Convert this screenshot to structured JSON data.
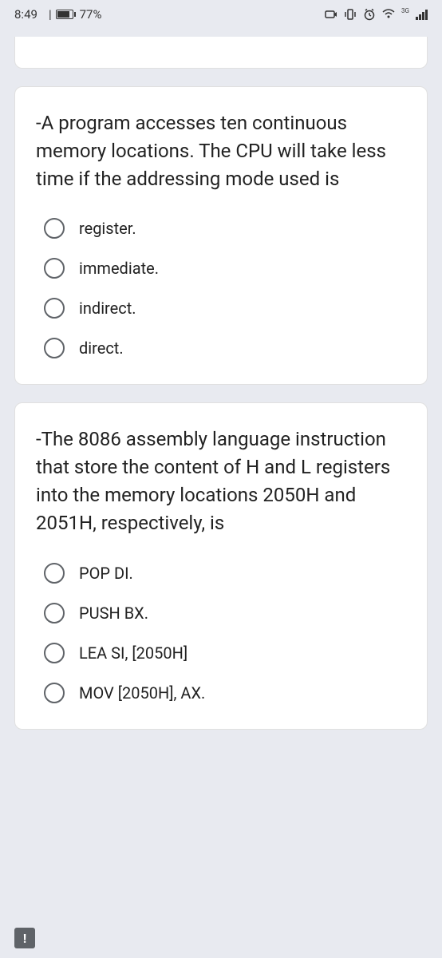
{
  "statusBar": {
    "time": "8:49",
    "batteryPercent": "77%",
    "network": "3G"
  },
  "questions": [
    {
      "prompt": "-A program accesses ten continuous memory locations. The CPU will take less time if the addressing mode used is",
      "options": [
        "register.",
        "immediate.",
        "indirect.",
        "direct."
      ]
    },
    {
      "prompt": "-The 8086 assembly language instruction that store the content of H and L registers into the memory locations 2050H and 2051H, respectively, is",
      "options": [
        "POP DI.",
        "PUSH BX.",
        "LEA SI, [2050H]",
        "MOV [2050H], AX."
      ]
    }
  ],
  "errorBadge": "!"
}
